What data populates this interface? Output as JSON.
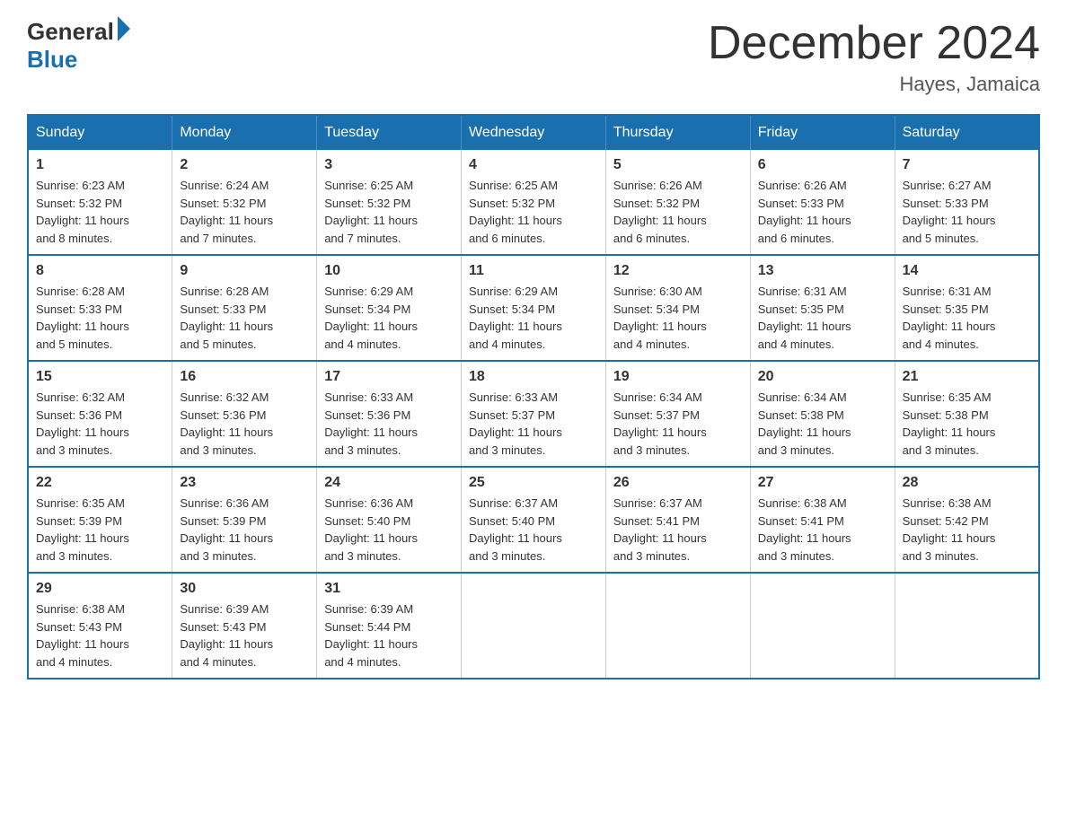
{
  "header": {
    "logo_general": "General",
    "logo_blue": "Blue",
    "month_title": "December 2024",
    "location": "Hayes, Jamaica"
  },
  "days_of_week": [
    "Sunday",
    "Monday",
    "Tuesday",
    "Wednesday",
    "Thursday",
    "Friday",
    "Saturday"
  ],
  "weeks": [
    [
      {
        "day": "1",
        "sunrise": "6:23 AM",
        "sunset": "5:32 PM",
        "daylight": "11 hours and 8 minutes."
      },
      {
        "day": "2",
        "sunrise": "6:24 AM",
        "sunset": "5:32 PM",
        "daylight": "11 hours and 7 minutes."
      },
      {
        "day": "3",
        "sunrise": "6:25 AM",
        "sunset": "5:32 PM",
        "daylight": "11 hours and 7 minutes."
      },
      {
        "day": "4",
        "sunrise": "6:25 AM",
        "sunset": "5:32 PM",
        "daylight": "11 hours and 6 minutes."
      },
      {
        "day": "5",
        "sunrise": "6:26 AM",
        "sunset": "5:32 PM",
        "daylight": "11 hours and 6 minutes."
      },
      {
        "day": "6",
        "sunrise": "6:26 AM",
        "sunset": "5:33 PM",
        "daylight": "11 hours and 6 minutes."
      },
      {
        "day": "7",
        "sunrise": "6:27 AM",
        "sunset": "5:33 PM",
        "daylight": "11 hours and 5 minutes."
      }
    ],
    [
      {
        "day": "8",
        "sunrise": "6:28 AM",
        "sunset": "5:33 PM",
        "daylight": "11 hours and 5 minutes."
      },
      {
        "day": "9",
        "sunrise": "6:28 AM",
        "sunset": "5:33 PM",
        "daylight": "11 hours and 5 minutes."
      },
      {
        "day": "10",
        "sunrise": "6:29 AM",
        "sunset": "5:34 PM",
        "daylight": "11 hours and 4 minutes."
      },
      {
        "day": "11",
        "sunrise": "6:29 AM",
        "sunset": "5:34 PM",
        "daylight": "11 hours and 4 minutes."
      },
      {
        "day": "12",
        "sunrise": "6:30 AM",
        "sunset": "5:34 PM",
        "daylight": "11 hours and 4 minutes."
      },
      {
        "day": "13",
        "sunrise": "6:31 AM",
        "sunset": "5:35 PM",
        "daylight": "11 hours and 4 minutes."
      },
      {
        "day": "14",
        "sunrise": "6:31 AM",
        "sunset": "5:35 PM",
        "daylight": "11 hours and 4 minutes."
      }
    ],
    [
      {
        "day": "15",
        "sunrise": "6:32 AM",
        "sunset": "5:36 PM",
        "daylight": "11 hours and 3 minutes."
      },
      {
        "day": "16",
        "sunrise": "6:32 AM",
        "sunset": "5:36 PM",
        "daylight": "11 hours and 3 minutes."
      },
      {
        "day": "17",
        "sunrise": "6:33 AM",
        "sunset": "5:36 PM",
        "daylight": "11 hours and 3 minutes."
      },
      {
        "day": "18",
        "sunrise": "6:33 AM",
        "sunset": "5:37 PM",
        "daylight": "11 hours and 3 minutes."
      },
      {
        "day": "19",
        "sunrise": "6:34 AM",
        "sunset": "5:37 PM",
        "daylight": "11 hours and 3 minutes."
      },
      {
        "day": "20",
        "sunrise": "6:34 AM",
        "sunset": "5:38 PM",
        "daylight": "11 hours and 3 minutes."
      },
      {
        "day": "21",
        "sunrise": "6:35 AM",
        "sunset": "5:38 PM",
        "daylight": "11 hours and 3 minutes."
      }
    ],
    [
      {
        "day": "22",
        "sunrise": "6:35 AM",
        "sunset": "5:39 PM",
        "daylight": "11 hours and 3 minutes."
      },
      {
        "day": "23",
        "sunrise": "6:36 AM",
        "sunset": "5:39 PM",
        "daylight": "11 hours and 3 minutes."
      },
      {
        "day": "24",
        "sunrise": "6:36 AM",
        "sunset": "5:40 PM",
        "daylight": "11 hours and 3 minutes."
      },
      {
        "day": "25",
        "sunrise": "6:37 AM",
        "sunset": "5:40 PM",
        "daylight": "11 hours and 3 minutes."
      },
      {
        "day": "26",
        "sunrise": "6:37 AM",
        "sunset": "5:41 PM",
        "daylight": "11 hours and 3 minutes."
      },
      {
        "day": "27",
        "sunrise": "6:38 AM",
        "sunset": "5:41 PM",
        "daylight": "11 hours and 3 minutes."
      },
      {
        "day": "28",
        "sunrise": "6:38 AM",
        "sunset": "5:42 PM",
        "daylight": "11 hours and 3 minutes."
      }
    ],
    [
      {
        "day": "29",
        "sunrise": "6:38 AM",
        "sunset": "5:43 PM",
        "daylight": "11 hours and 4 minutes."
      },
      {
        "day": "30",
        "sunrise": "6:39 AM",
        "sunset": "5:43 PM",
        "daylight": "11 hours and 4 minutes."
      },
      {
        "day": "31",
        "sunrise": "6:39 AM",
        "sunset": "5:44 PM",
        "daylight": "11 hours and 4 minutes."
      },
      null,
      null,
      null,
      null
    ]
  ],
  "labels": {
    "sunrise": "Sunrise:",
    "sunset": "Sunset:",
    "daylight": "Daylight:"
  }
}
